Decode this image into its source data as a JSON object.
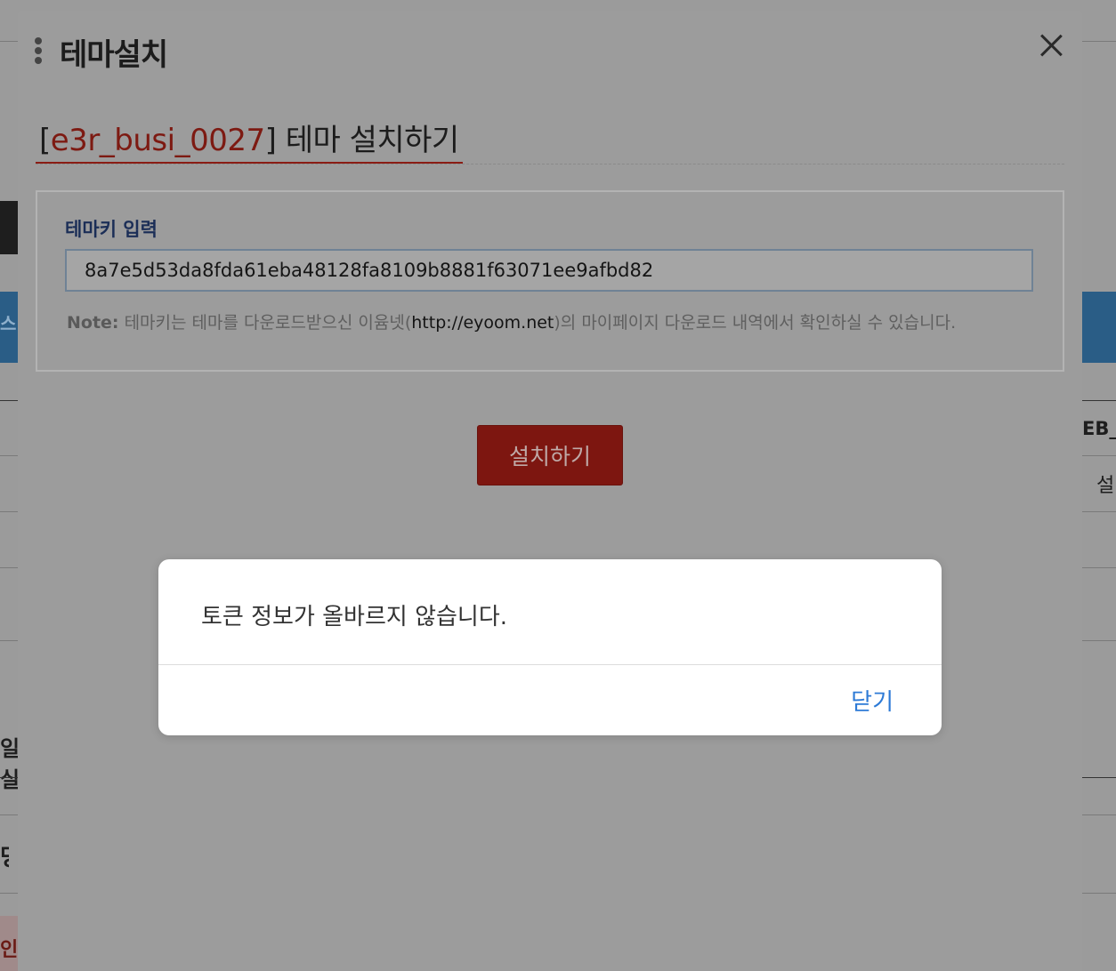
{
  "modal": {
    "title": "테마설치",
    "heading": {
      "open_bracket": "[",
      "theme_code": "e3r_busi_0027",
      "close_bracket_and_text": "] 테마 설치하기"
    },
    "key_label": "테마키 입력",
    "key_value": "8a7e5d53da8fda61eba48128fa8109b8881f63071ee9afbd82",
    "note": {
      "label": "Note:",
      "text_before": " 테마키는 테마를 다운로드받으신 이윰넷(",
      "url": "http://eyoom.net",
      "text_after": ")의 마이페이지 다운로드 내역에서 확인하실 수 있습니다."
    },
    "install_button": "설치하기"
  },
  "alert": {
    "message": "토큰 정보가 올바르지 않습니다.",
    "close_button": "닫기"
  },
  "background": {
    "left_fragment_1": "스",
    "left_fragment_2": "일실",
    "left_fragment_3": "명",
    "left_fragment_4": "인",
    "right_fragment_1": "EB_",
    "right_fragment_2": "설"
  },
  "colors": {
    "accent_red": "#c4261d",
    "link_blue": "#2d7ad6",
    "label_navy": "#1b2e57"
  },
  "icons": {
    "close": "close-icon",
    "drag": "drag-handle-icon"
  }
}
